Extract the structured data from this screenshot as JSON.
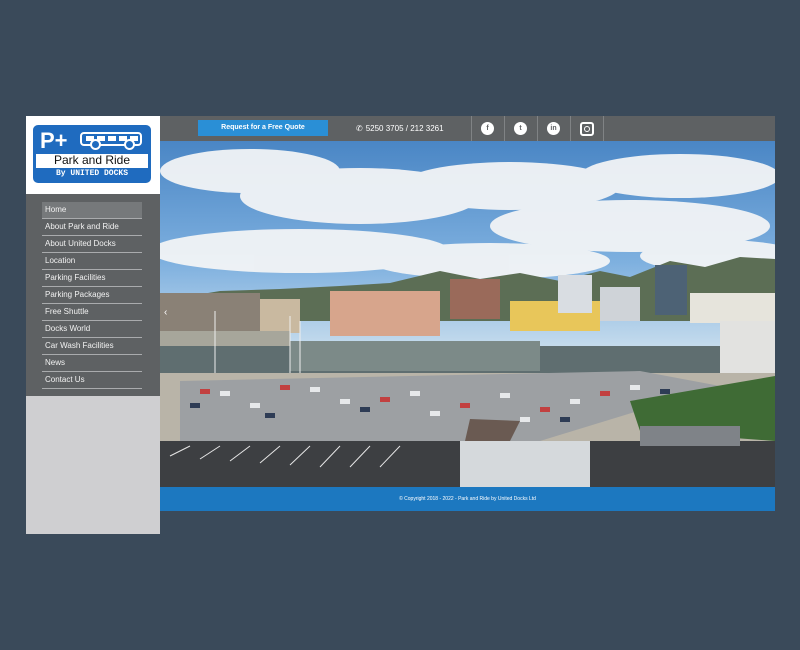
{
  "logo": {
    "prefix": "P+",
    "name": "Park and Ride",
    "sub": "By UNITED DOCKS"
  },
  "nav": {
    "items": [
      {
        "label": "Home",
        "active": true
      },
      {
        "label": "About Park and Ride"
      },
      {
        "label": "About United Docks"
      },
      {
        "label": "Location"
      },
      {
        "label": "Parking Facilities"
      },
      {
        "label": "Parking Packages"
      },
      {
        "label": "Free Shuttle"
      },
      {
        "label": "Docks World"
      },
      {
        "label": "Car Wash Facilities"
      },
      {
        "label": "News"
      },
      {
        "label": "Contact Us"
      }
    ]
  },
  "topbar": {
    "quote_label": "Request for a Free Quote",
    "phone_icon": "phone-icon",
    "phone": "5250 3705 / 212 3261",
    "social": [
      {
        "icon": "facebook-icon",
        "glyph": "f"
      },
      {
        "icon": "twitter-icon",
        "glyph": "t"
      },
      {
        "icon": "linkedin-icon",
        "glyph": "in"
      },
      {
        "icon": "instagram-icon",
        "glyph": ""
      }
    ]
  },
  "hero": {
    "arrow_icon": "chevron-left-icon",
    "arrow_glyph": "‹"
  },
  "footer": {
    "copyright": "© Copyright 2018 - 2022 - Park and Ride by United Docks Ltd"
  },
  "colors": {
    "page_bg": "#3a4a5a",
    "accent": "#1c78c0",
    "button": "#2a8fd6",
    "sidebar": "#5e6163"
  }
}
